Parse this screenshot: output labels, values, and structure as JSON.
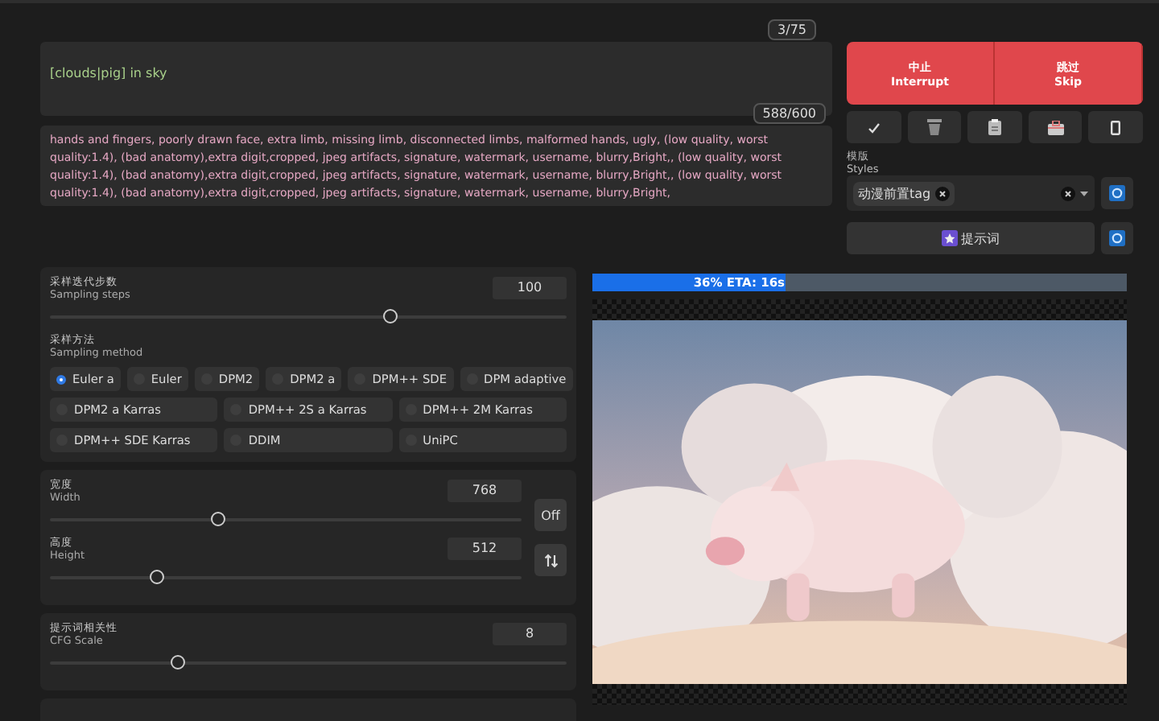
{
  "prompt": {
    "value": "[clouds|pig] in sky",
    "counter": "3/75"
  },
  "negative_prompt": {
    "value": "hands and fingers, poorly drawn face, extra limb, missing limb, disconnected limbs, malformed hands, ugly, (low quality, worst quality:1.4), (bad anatomy),extra digit,cropped, jpeg artifacts, signature, watermark, username, blurry,Bright,, (low quality, worst quality:1.4), (bad anatomy),extra digit,cropped, jpeg artifacts, signature, watermark, username, blurry,Bright,, (low quality, worst quality:1.4), (bad anatomy),extra digit,cropped, jpeg artifacts, signature, watermark, username, blurry,Bright,",
    "counter": "588/600"
  },
  "actions": [
    {
      "zh": "中止",
      "en": "Interrupt"
    },
    {
      "zh": "跳过",
      "en": "Skip"
    }
  ],
  "tools": [
    {
      "kind": "check"
    },
    {
      "kind": "trash"
    },
    {
      "kind": "clipboard"
    },
    {
      "kind": "bag"
    },
    {
      "kind": "frame"
    }
  ],
  "styles": {
    "label_zh": "模版",
    "label_en": "Styles",
    "tags": [
      "动漫前置tag"
    ]
  },
  "prompt_button": "提示词",
  "steps": {
    "label_zh": "采样迭代步数",
    "label_en": "Sampling steps",
    "value": "100",
    "level": 0.66
  },
  "sampler": {
    "label_zh": "采样方法",
    "label_en": "Sampling method",
    "rows": [
      [
        {
          "label": "Euler a",
          "selected": true
        },
        {
          "label": "Euler",
          "selected": false
        },
        {
          "label": "DPM2",
          "selected": false
        },
        {
          "label": "DPM2 a",
          "selected": false
        },
        {
          "label": "DPM++ SDE",
          "selected": false
        },
        {
          "label": "DPM adaptive",
          "selected": false
        }
      ],
      [
        {
          "label": "DPM2 a Karras",
          "selected": false
        },
        {
          "label": "DPM++ 2S a Karras",
          "selected": false
        },
        {
          "label": "DPM++ 2M Karras",
          "selected": false
        }
      ],
      [
        {
          "label": "DPM++ SDE Karras",
          "selected": false
        },
        {
          "label": "DDIM",
          "selected": false
        },
        {
          "label": "UniPC",
          "selected": false
        }
      ]
    ]
  },
  "size": [
    {
      "label_zh": "宽度",
      "label_en": "Width",
      "value": "768",
      "level": 0.36
    },
    {
      "label_zh": "高度",
      "label_en": "Height",
      "value": "512",
      "level": 0.23
    }
  ],
  "off_button": "Off",
  "cfg": {
    "label_zh": "提示词相关性",
    "label_en": "CFG Scale",
    "value": "8",
    "level": 0.25
  },
  "progress": {
    "text": "36% ETA: 16s",
    "level": 0.36
  }
}
